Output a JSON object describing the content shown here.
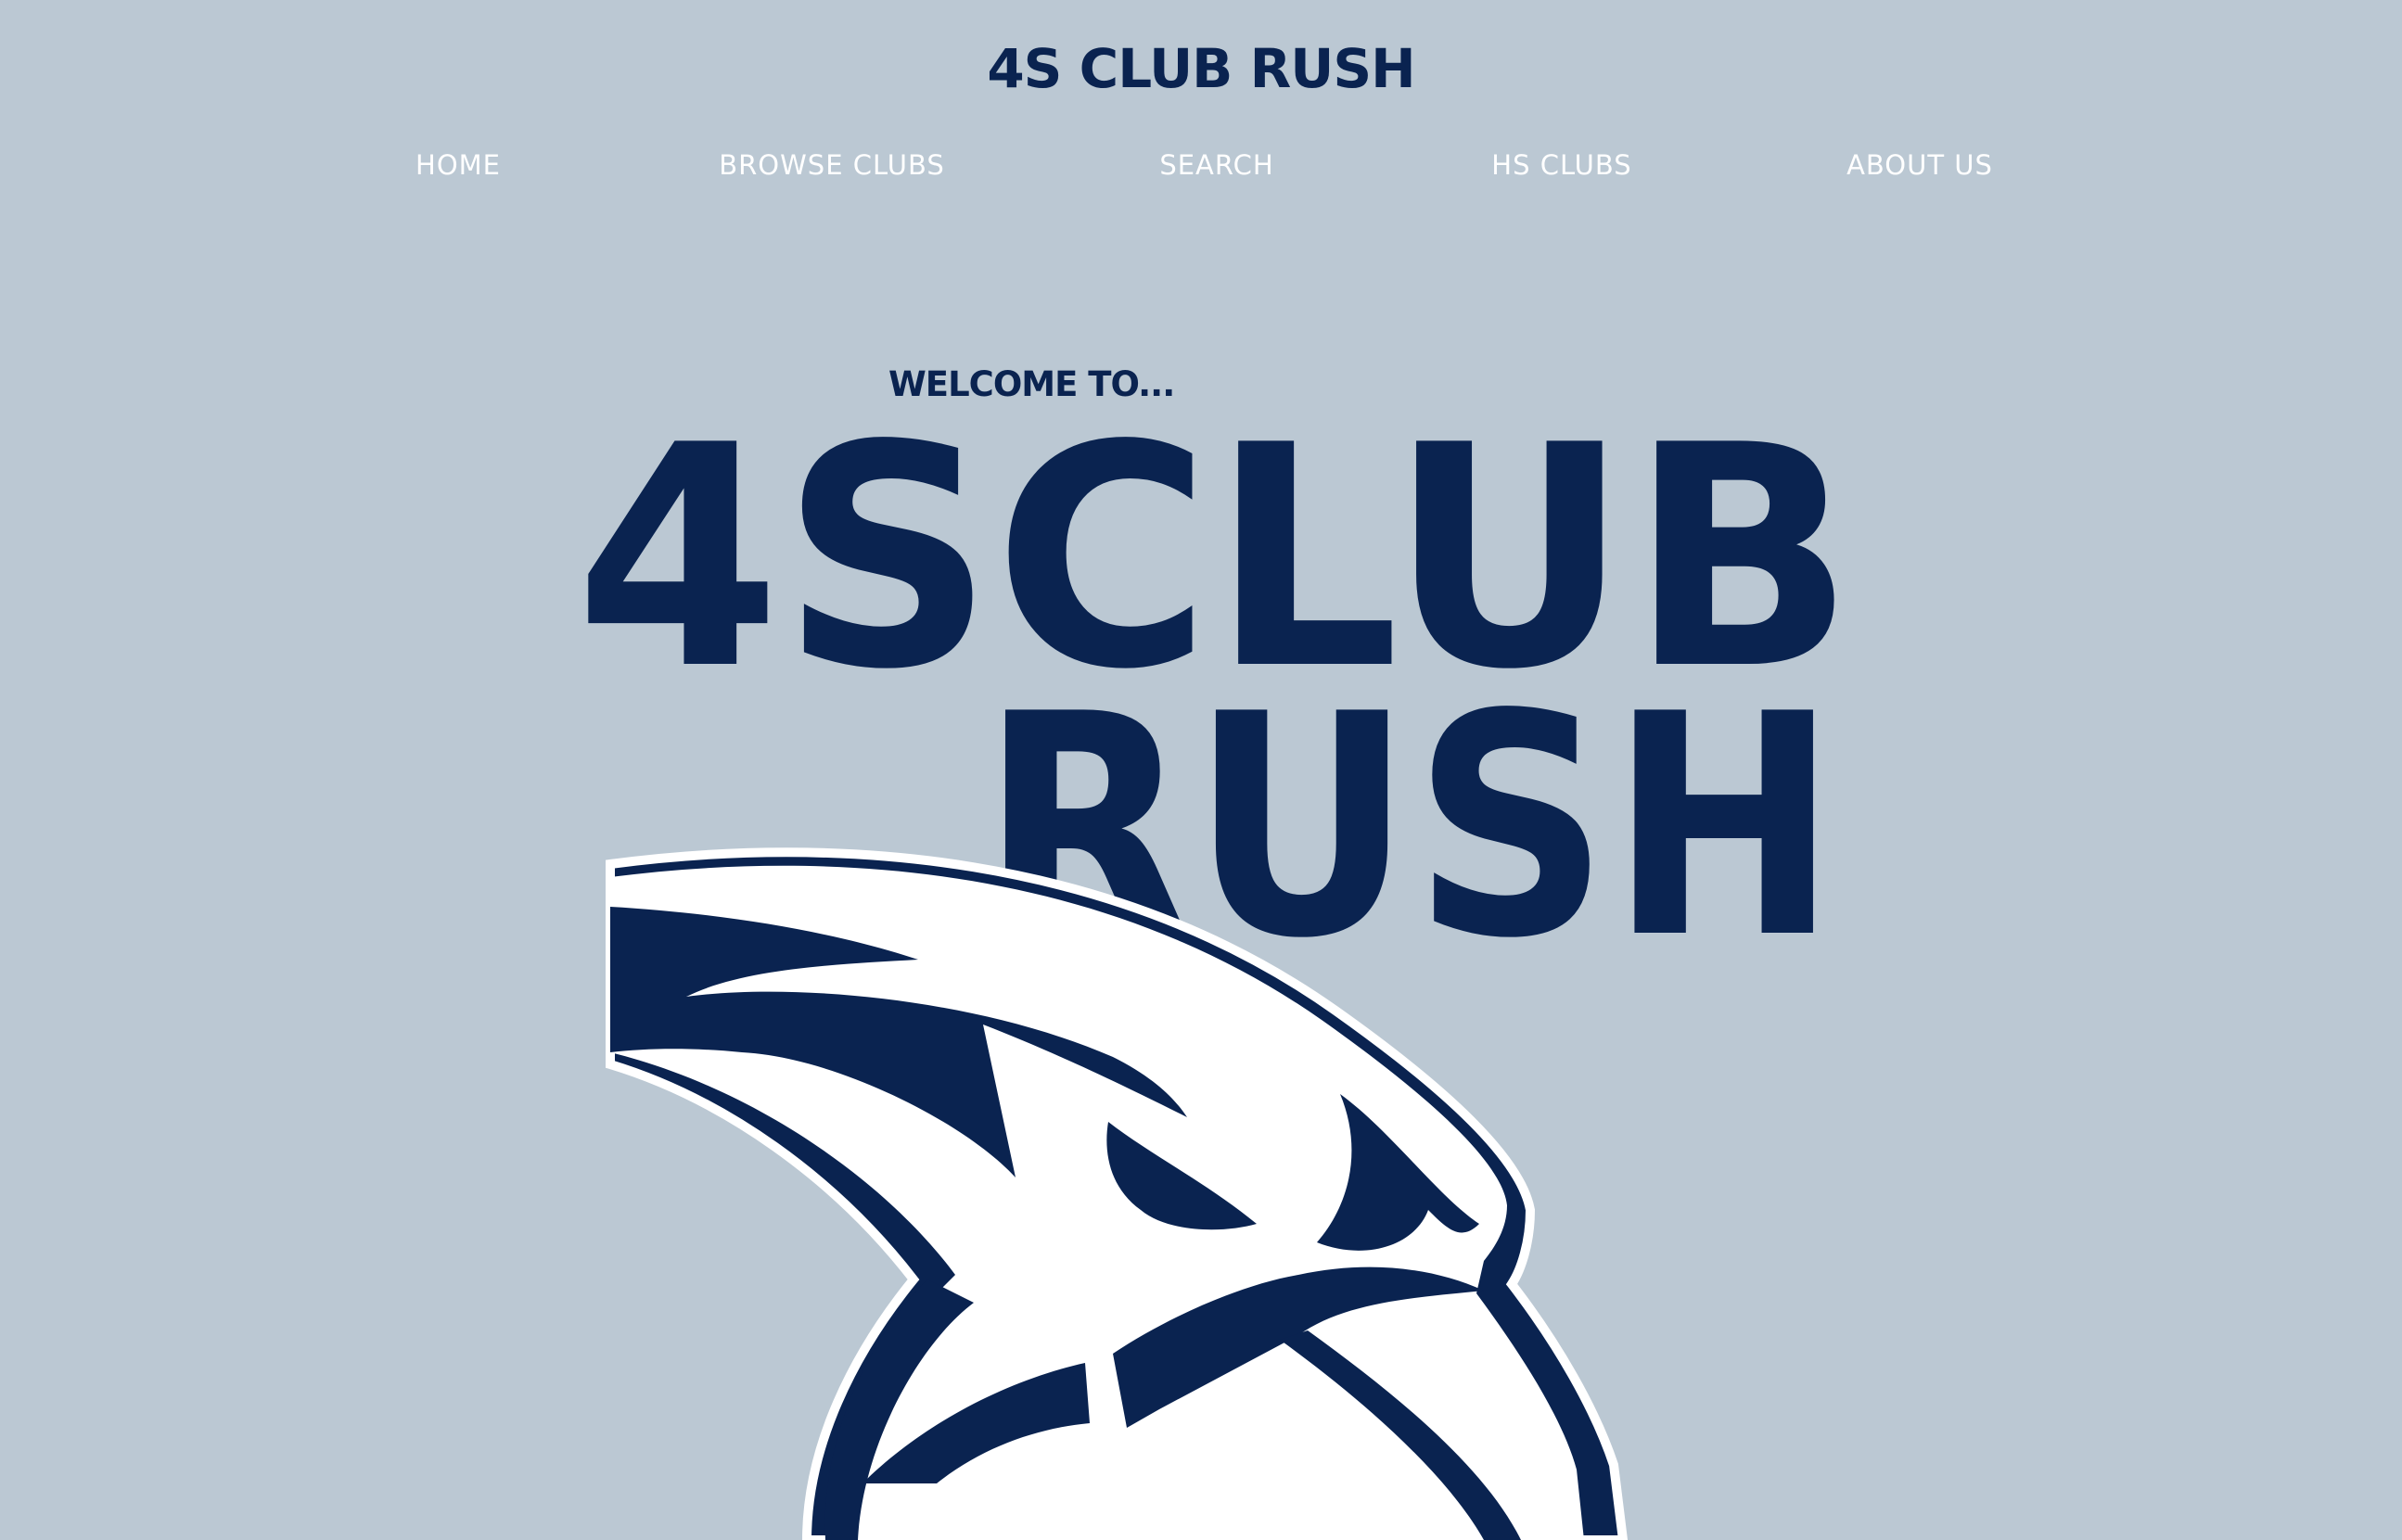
{
  "colors": {
    "background": "#bbc8d3",
    "navy": "#0a2350",
    "nav_text": "#ffffff",
    "mascot_white": "#ffffff"
  },
  "header": {
    "title": "4S CLUB RUSH"
  },
  "nav": {
    "items": [
      {
        "label": "HOME"
      },
      {
        "label": "BROWSE CLUBS"
      },
      {
        "label": "SEARCH"
      },
      {
        "label": "HS CLUBS"
      },
      {
        "label": "ABOUT US"
      }
    ]
  },
  "hero": {
    "welcome": "WELCOME TO...",
    "line1": "4SCLUB",
    "line2": "RUSH"
  },
  "mascot": {
    "icon": "hawk-mascot-icon"
  }
}
